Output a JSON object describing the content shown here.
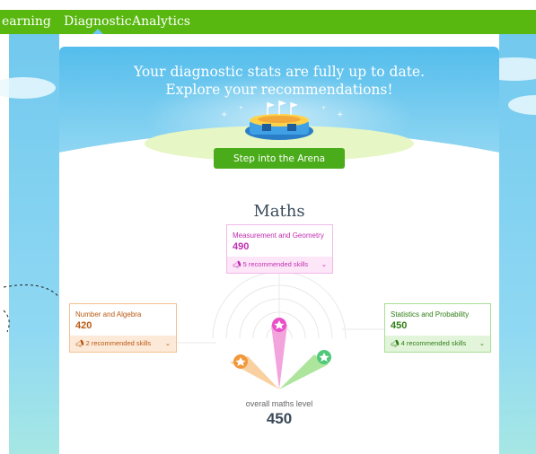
{
  "nav": {
    "items": [
      {
        "label": "earning"
      },
      {
        "label": "Diagnostic"
      },
      {
        "label": "Analytics"
      }
    ],
    "active": "Diagnostic"
  },
  "hero": {
    "title_line1": "Your diagnostic stats are fully up to date.",
    "title_line2": "Explore your recommendations!",
    "button_label": "Step into the Arena"
  },
  "subject": {
    "title": "Maths"
  },
  "strands": [
    {
      "name": "Measurement and Geometry",
      "score": "490",
      "recommendation": "5 recommended skills",
      "color": "#c02eb0",
      "bg": "#fde6f8",
      "border": "#f3b7ea"
    },
    {
      "name": "Number and Algebra",
      "score": "420",
      "recommendation": "2 recommended skills",
      "color": "#b95a12",
      "bg": "#fde9d8",
      "border": "#f6c091"
    },
    {
      "name": "Statistics and Probability",
      "score": "450",
      "recommendation": "4 recommended skills",
      "color": "#2f7d15",
      "bg": "#e2f5db",
      "border": "#a9dd95"
    }
  ],
  "overall": {
    "label": "overall maths level",
    "score": "450"
  },
  "icons": {
    "recommend": "megaphone-icon",
    "expand": "chevron-down-icon",
    "marker": "star-icon",
    "arena": "stadium-icon"
  },
  "colors": {
    "nav_green": "#58b80f",
    "button_green": "#4aac1a",
    "sky_blue": "#72c9ee"
  }
}
